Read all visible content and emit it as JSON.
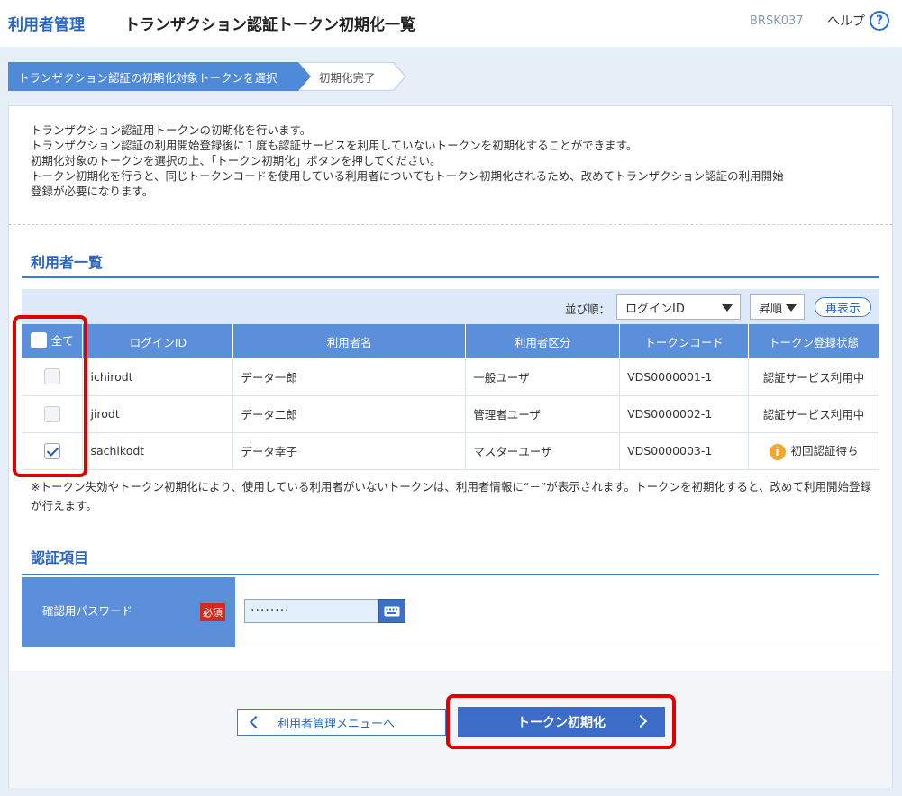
{
  "header": {
    "system_title": "利用者管理",
    "page_title": "トランザクション認証トークン初期化一覧",
    "screen_id": "BRSK037",
    "help_label": "ヘルプ",
    "help_icon": "?"
  },
  "steps": [
    {
      "label": "トランザクション認証の初期化対象トークンを選択",
      "active": true
    },
    {
      "label": "初期化完了",
      "active": false
    }
  ],
  "intro": [
    "トランザクション認証用トークンの初期化を行います。",
    "トランザクション認証の利用開始登録後に１度も認証サービスを利用していないトークンを初期化することができます。",
    "初期化対象のトークンを選択の上、「トークン初期化」ボタンを押してください。",
    "トークン初期化を行うと、同じトークンコードを使用している利用者についてもトークン初期化されるため、改めてトランザクション認証の利用開始",
    "登録が必要になります。"
  ],
  "user_list": {
    "title": "利用者一覧",
    "sort_label": "並び順：",
    "sort_key": "ログインID",
    "sort_order": "昇順",
    "redisplay_label": "再表示",
    "columns": {
      "select_all": "全て",
      "login_id": "ログインID",
      "user_name": "利用者名",
      "user_type": "利用者区分",
      "token_code": "トークンコード",
      "token_status": "トークン登録状態"
    },
    "rows": [
      {
        "checked": false,
        "login_id": "ichirodt",
        "user_name": "データ一郎",
        "user_type": "一般ユーザ",
        "token_code": "VDS0000001-1",
        "token_status": "認証サービス利用中",
        "status_icon": ""
      },
      {
        "checked": false,
        "login_id": "jirodt",
        "user_name": "データ二郎",
        "user_type": "管理者ユーザ",
        "token_code": "VDS0000002-1",
        "token_status": "認証サービス利用中",
        "status_icon": ""
      },
      {
        "checked": true,
        "login_id": "sachikodt",
        "user_name": "データ幸子",
        "user_type": "マスターユーザ",
        "token_code": "VDS0000003-1",
        "token_status": "初回認証待ち",
        "status_icon": "i"
      }
    ],
    "note": "※トークン失効やトークン初期化により、使用している利用者がいないトークンは、利用者情報に“－”が表示されます。トークンを初期化すると、改めて利用開始登録が行えます。"
  },
  "auth": {
    "title": "認証項目",
    "password_label": "確認用パスワード",
    "required_label": "必須",
    "password_value": "········"
  },
  "buttons": {
    "back_label": "利用者管理メニューへ",
    "execute_label": "トークン初期化"
  },
  "colors": {
    "accent": "#2a66c0",
    "header_cell": "#5b8fda",
    "highlight": "#e00000",
    "required": "#d42a1e"
  }
}
